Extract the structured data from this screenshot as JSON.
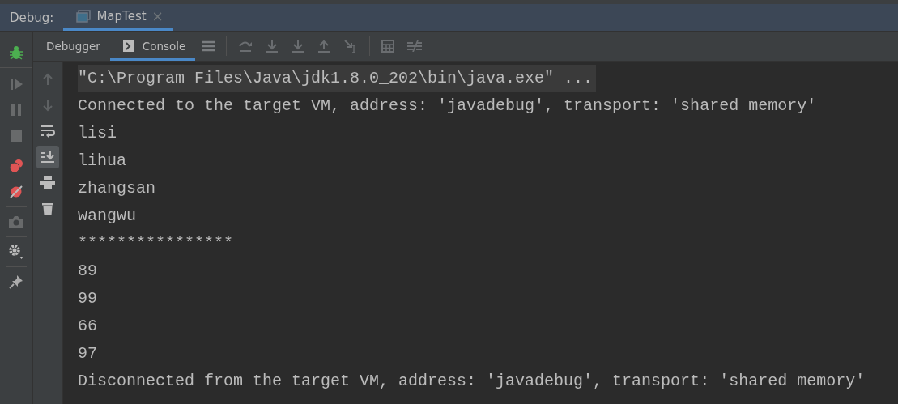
{
  "debug_bar": {
    "label": "Debug:",
    "tab": {
      "title": "MapTest",
      "close": "×",
      "selected": true
    }
  },
  "tabs": [
    {
      "label": "Debugger",
      "selected": false
    },
    {
      "label": "Console",
      "selected": true
    }
  ],
  "left_tools": [
    {
      "kind": "bug",
      "disabled": false
    },
    {
      "kind": "resume",
      "disabled": true
    },
    {
      "kind": "pause",
      "disabled": true
    },
    {
      "kind": "stop",
      "disabled": true
    },
    {
      "kind": "breakpoints",
      "disabled": false
    },
    {
      "kind": "mute",
      "disabled": false
    },
    {
      "kind": "camera",
      "disabled": true
    },
    {
      "kind": "settings",
      "disabled": false
    },
    {
      "kind": "pin",
      "disabled": false
    }
  ],
  "console_tools": [
    {
      "kind": "up",
      "on": false
    },
    {
      "kind": "down",
      "on": false
    },
    {
      "kind": "wrap",
      "on": false
    },
    {
      "kind": "scroll-end",
      "on": true
    },
    {
      "kind": "print",
      "on": false
    },
    {
      "kind": "trash",
      "on": false
    }
  ],
  "console": [
    {
      "text": "\"C:\\Program Files\\Java\\jdk1.8.0_202\\bin\\java.exe\" ...",
      "kind": "command"
    },
    {
      "text": "Connected to the target VM, address: 'javadebug', transport: 'shared memory'",
      "kind": "output"
    },
    {
      "text": "lisi",
      "kind": "output"
    },
    {
      "text": "lihua",
      "kind": "output"
    },
    {
      "text": "zhangsan",
      "kind": "output"
    },
    {
      "text": "wangwu",
      "kind": "output"
    },
    {
      "text": "****************",
      "kind": "output"
    },
    {
      "text": "89",
      "kind": "output"
    },
    {
      "text": "99",
      "kind": "output"
    },
    {
      "text": "66",
      "kind": "output"
    },
    {
      "text": "97",
      "kind": "output"
    },
    {
      "text": "Disconnected from the target VM, address: 'javadebug', transport: 'shared memory'",
      "kind": "output"
    }
  ]
}
